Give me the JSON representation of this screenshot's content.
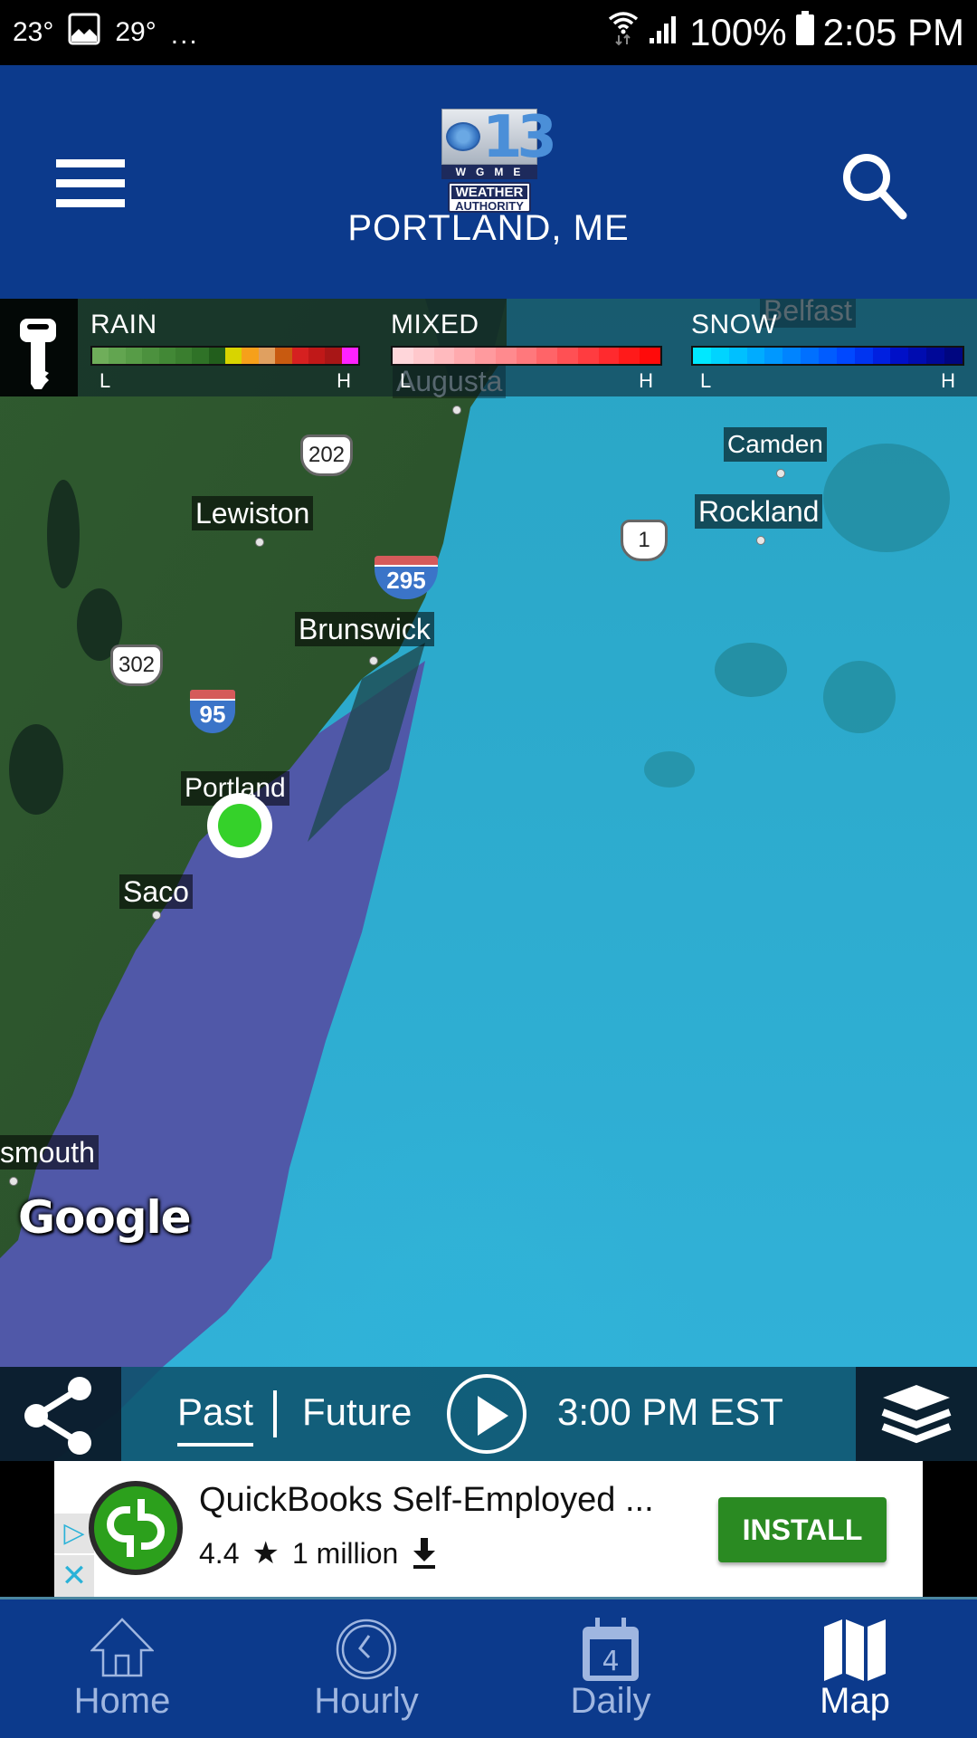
{
  "status_bar": {
    "temp_current": "23°",
    "temp_high": "29°",
    "more_notifications": "...",
    "battery": "100%",
    "time": "2:05 PM",
    "icons": [
      "image-icon",
      "wifi-icon",
      "signal-icon",
      "battery-icon"
    ]
  },
  "header": {
    "menu_icon": "hamburger-icon",
    "logo": {
      "number": "13",
      "station": "WGME",
      "line1": "WEATHER",
      "line2": "AUTHORITY"
    },
    "location": "PORTLAND, ME",
    "search_icon": "search-icon"
  },
  "legend": {
    "key_icon": "key-icon",
    "groups": [
      {
        "title": "RAIN",
        "low": "L",
        "high": "H",
        "colors": [
          "#6fae5a",
          "#62a550",
          "#579c47",
          "#4c913e",
          "#428836",
          "#3a7e2f",
          "#2f7227",
          "#225e1c",
          "#d8d400",
          "#f6a01a",
          "#e0a060",
          "#c85a10",
          "#d62020",
          "#c01818",
          "#a81616",
          "#ff22ff"
        ]
      },
      {
        "title": "MIXED",
        "low": "L",
        "high": "H",
        "colors": [
          "#ffd6da",
          "#ffc8cc",
          "#ffbabe",
          "#ffaaae",
          "#ff9a9e",
          "#ff8a8e",
          "#ff787c",
          "#ff6468",
          "#ff5054",
          "#ff3c40",
          "#ff2a2e",
          "#ff1a1a",
          "#ff0a0a"
        ]
      },
      {
        "title": "SNOW",
        "low": "L",
        "high": "H",
        "colors": [
          "#00e8ff",
          "#00d4ff",
          "#00c0ff",
          "#00acff",
          "#0098ff",
          "#0084ff",
          "#0070ff",
          "#005cff",
          "#0048ff",
          "#0034f0",
          "#0020e0",
          "#0010c8",
          "#000cb0",
          "#000898",
          "#000680"
        ]
      }
    ]
  },
  "map": {
    "labels": {
      "belfast": "Belfast",
      "augusta": "Augusta",
      "camden": "Camden",
      "rockland": "Rockland",
      "lewiston": "Lewiston",
      "brunswick": "Brunswick",
      "portland": "Portland",
      "saco": "Saco",
      "portsmouth": "smouth"
    },
    "shields": {
      "us202": "202",
      "us302": "302",
      "us1": "1",
      "i295": "295",
      "i95": "95"
    },
    "attribution": "Google",
    "marker_color": "#35d12a"
  },
  "timeline": {
    "share_icon": "share-icon",
    "past_label": "Past",
    "future_label": "Future",
    "active_tab": "Past",
    "play_icon": "play-icon",
    "time": "3:00 PM EST",
    "layers_icon": "layers-icon"
  },
  "ad": {
    "choices_icon": "adchoices-icon",
    "close_icon": "close-icon",
    "app_icon": "quickbooks-icon",
    "title": "QuickBooks Self-Employed ...",
    "rating": "4.4",
    "downloads": "1 million",
    "install_label": "INSTALL",
    "install_color": "#2a8a22"
  },
  "bottom_nav": {
    "items": [
      {
        "label": "Home",
        "icon": "home-icon"
      },
      {
        "label": "Hourly",
        "icon": "clock-icon"
      },
      {
        "label": "Daily",
        "icon": "calendar-icon",
        "badge": "4"
      },
      {
        "label": "Map",
        "icon": "map-icon",
        "active": true
      }
    ]
  },
  "colors": {
    "brand_blue": "#0c3a8c",
    "status_bar": "#000000",
    "nav_inactive": "#9fb6e0"
  }
}
